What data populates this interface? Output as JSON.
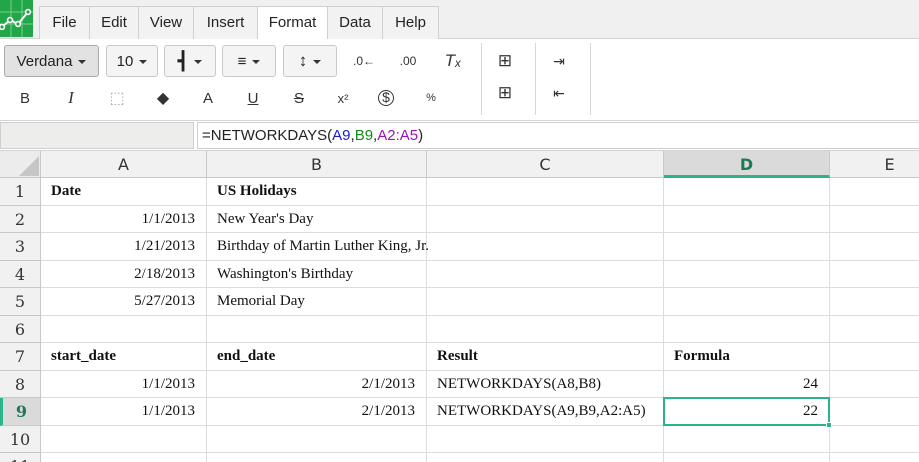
{
  "menu": [
    "File",
    "Edit",
    "View",
    "Insert",
    "Format",
    "Data",
    "Help"
  ],
  "menu_active": "Format",
  "toolbar": {
    "font_family": "Verdana",
    "font_size": "10"
  },
  "formula_bar": {
    "name_box": "",
    "formula_parts": [
      "=NETWORKDAYS(",
      "A9",
      ",",
      "B9",
      ",",
      "A2:A5",
      ")"
    ]
  },
  "columns": [
    "A",
    "B",
    "C",
    "D",
    "E"
  ],
  "selected_column": "D",
  "rows": [
    "1",
    "2",
    "3",
    "4",
    "5",
    "6",
    "7",
    "8",
    "9",
    "10",
    "11"
  ],
  "selected_row": "9",
  "cells": {
    "r1": [
      "Date",
      "US Holidays",
      "",
      ""
    ],
    "r2": [
      "1/1/2013",
      "New Year's Day",
      "",
      ""
    ],
    "r3": [
      "1/21/2013",
      "Birthday of Martin Luther King, Jr.",
      "",
      ""
    ],
    "r4": [
      "2/18/2013",
      "Washington's Birthday",
      "",
      ""
    ],
    "r5": [
      "5/27/2013",
      "Memorial Day",
      "",
      ""
    ],
    "r6": [
      "",
      "",
      "",
      ""
    ],
    "r7": [
      "start_date",
      "end_date",
      "Result",
      "Formula"
    ],
    "r8": [
      "1/1/2013",
      "2/1/2013",
      "NETWORKDAYS(A8,B8)",
      "24"
    ],
    "r9": [
      "1/1/2013",
      "2/1/2013",
      "NETWORKDAYS(A9,B9,A2:A5)",
      "22"
    ],
    "r10": [
      "",
      "",
      "",
      ""
    ]
  },
  "colors": {
    "accent": "#2bb38b",
    "logo": "#22a64a"
  }
}
